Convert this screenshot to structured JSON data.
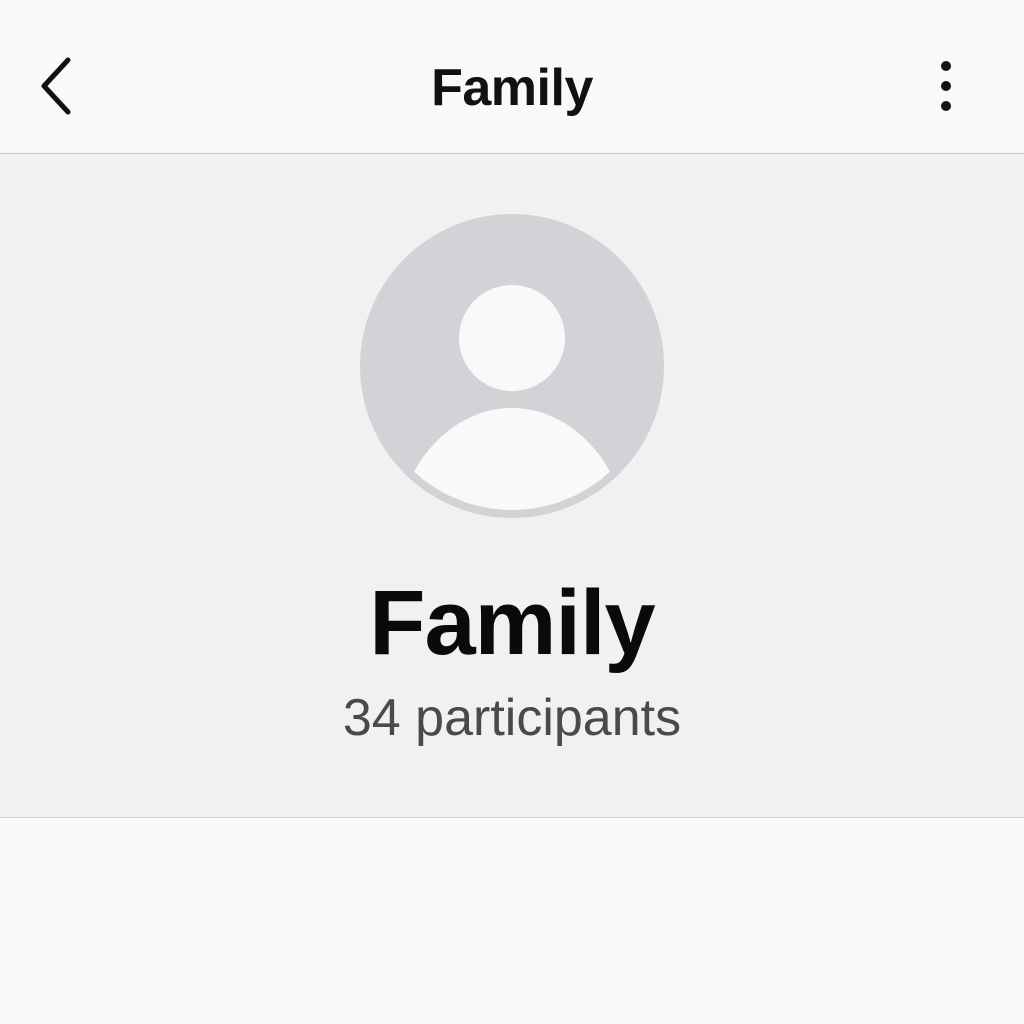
{
  "nav": {
    "title": "Family",
    "back_icon": "chevron-left-icon",
    "more_icon": "vertical-ellipsis-icon"
  },
  "group": {
    "name": "Family",
    "participants": "34 participants",
    "avatar_icon": "person-placeholder-icon"
  },
  "colors": {
    "avatar_bg": "#d1d3d7",
    "avatar_fg": "#f9f9f9",
    "separator": "#c6c6c8"
  }
}
